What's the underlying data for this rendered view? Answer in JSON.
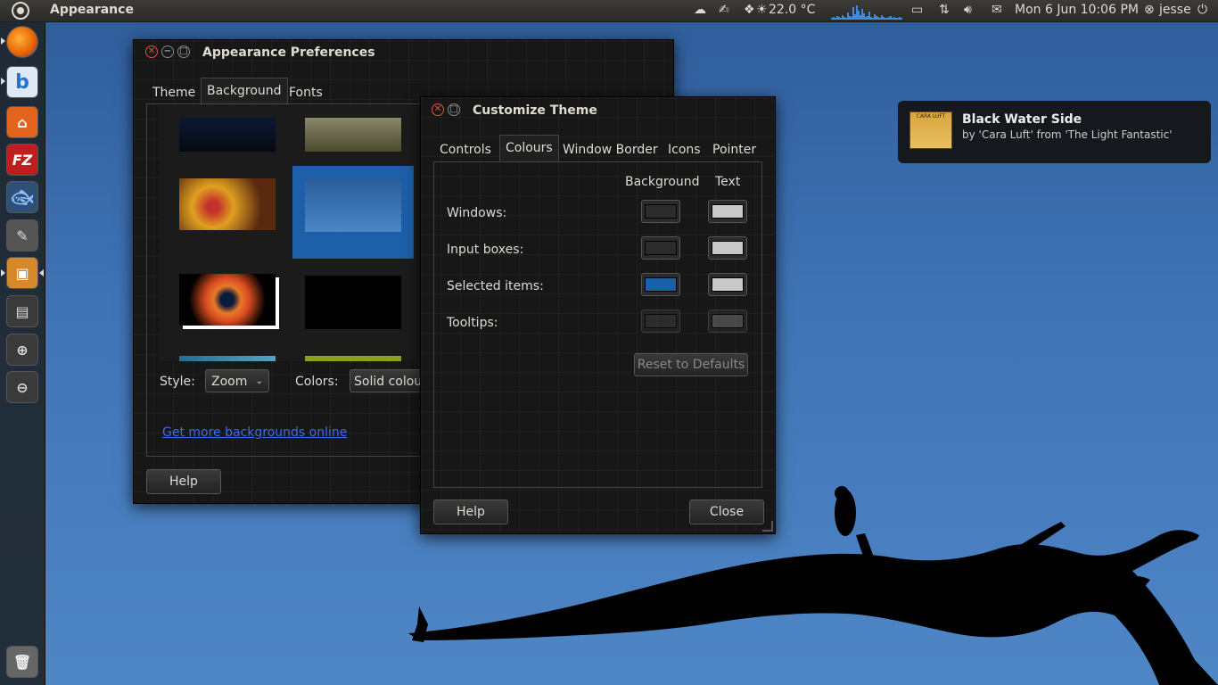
{
  "topbar": {
    "app_title": "Appearance",
    "temperature": "22.0 °C",
    "clock": "Mon  6 Jun 10:06 PM",
    "user": "jesse",
    "icons": [
      "weather-cloud-icon",
      "text-editor-icon",
      "dropbox-icon",
      "weather-sun-icon",
      "network-graph-icon",
      "battery-icon",
      "network-updown-icon",
      "volume-icon",
      "mail-icon",
      "user-status-icon",
      "power-icon"
    ]
  },
  "launcher": {
    "items": [
      {
        "name": "firefox-icon",
        "glyph": "",
        "color": "#e66000"
      },
      {
        "name": "bibletime-icon",
        "glyph": "b",
        "color": "#2a6fc9"
      },
      {
        "name": "home-folder-icon",
        "glyph": "⌂",
        "color": "#e2641f"
      },
      {
        "name": "filezilla-icon",
        "glyph": "FZ",
        "color": "#bf1e1e"
      },
      {
        "name": "pidgin-icon",
        "glyph": "✆",
        "color": "#4a8fd8"
      },
      {
        "name": "gimp-icon",
        "glyph": "✎",
        "color": "#7a6a55"
      },
      {
        "name": "ubuntu-software-center-icon",
        "glyph": "▣",
        "color": "#d6892c"
      },
      {
        "name": "workspace-switcher-icon",
        "glyph": "▤",
        "color": "#444"
      },
      {
        "name": "zoom-in-icon",
        "glyph": "⊕",
        "color": "#555"
      },
      {
        "name": "zoom-out-icon",
        "glyph": "⊖",
        "color": "#555"
      }
    ],
    "trash_icon": "trash-icon"
  },
  "appearance": {
    "title": "Appearance Preferences",
    "tabs": [
      "Theme",
      "Background",
      "Fonts"
    ],
    "active_tab": "Background",
    "style_label": "Style:",
    "style_value": "Zoom",
    "colors_label": "Colors:",
    "colors_value": "Solid colour",
    "link": "Get more backgrounds online",
    "help": "Help"
  },
  "customize": {
    "title": "Customize Theme",
    "tabs": [
      "Controls",
      "Colours",
      "Window Border",
      "Icons",
      "Pointer"
    ],
    "active_tab": "Colours",
    "col_background": "Background",
    "col_text": "Text",
    "rows": [
      {
        "label": "Windows:",
        "bg": "#2b2b2b",
        "text": "#c9c9c9"
      },
      {
        "label": "Input boxes:",
        "bg": "#2b2b2b",
        "text": "#c9c9c9"
      },
      {
        "label": "Selected items:",
        "bg": "#1b5fa8",
        "text": "#c9c9c9"
      },
      {
        "label": "Tooltips:",
        "bg": "#3a3a3a",
        "text": "#6a6a6a"
      }
    ],
    "reset": "Reset to Defaults",
    "help": "Help",
    "close": "Close"
  },
  "notification": {
    "title": "Black Water Side",
    "body": "by 'Cara Luft' from 'The Light Fantastic'",
    "album_art_text": "CARA LUFT"
  }
}
